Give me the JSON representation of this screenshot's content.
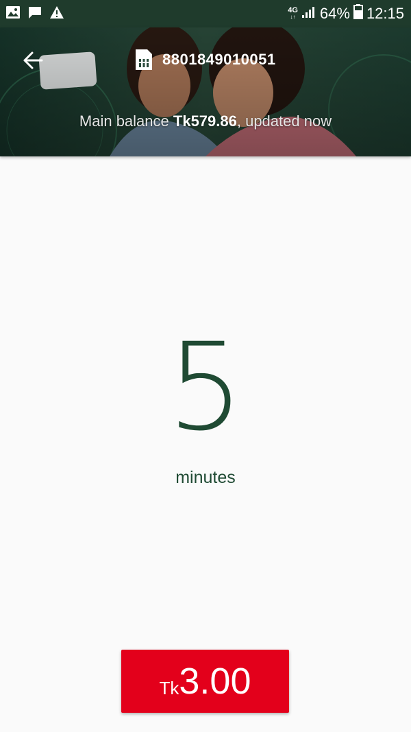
{
  "status_bar": {
    "network_type": "4G",
    "network_sub": "↓↑",
    "battery": "64%",
    "time": "12:15",
    "notification_icons": [
      "image-icon",
      "message-icon",
      "warning-icon"
    ]
  },
  "header": {
    "phone_number": "8801849010051",
    "balance_label": "Main balance",
    "balance_amount": "Tk579.86",
    "balance_suffix": ", updated now"
  },
  "package": {
    "value": "5",
    "unit": "minutes"
  },
  "price_button": {
    "currency": "Tk",
    "amount": "3.00"
  },
  "colors": {
    "accent_green": "#1f4a33",
    "button_red": "#e3001b",
    "status_bar": "#1f3b2c"
  }
}
